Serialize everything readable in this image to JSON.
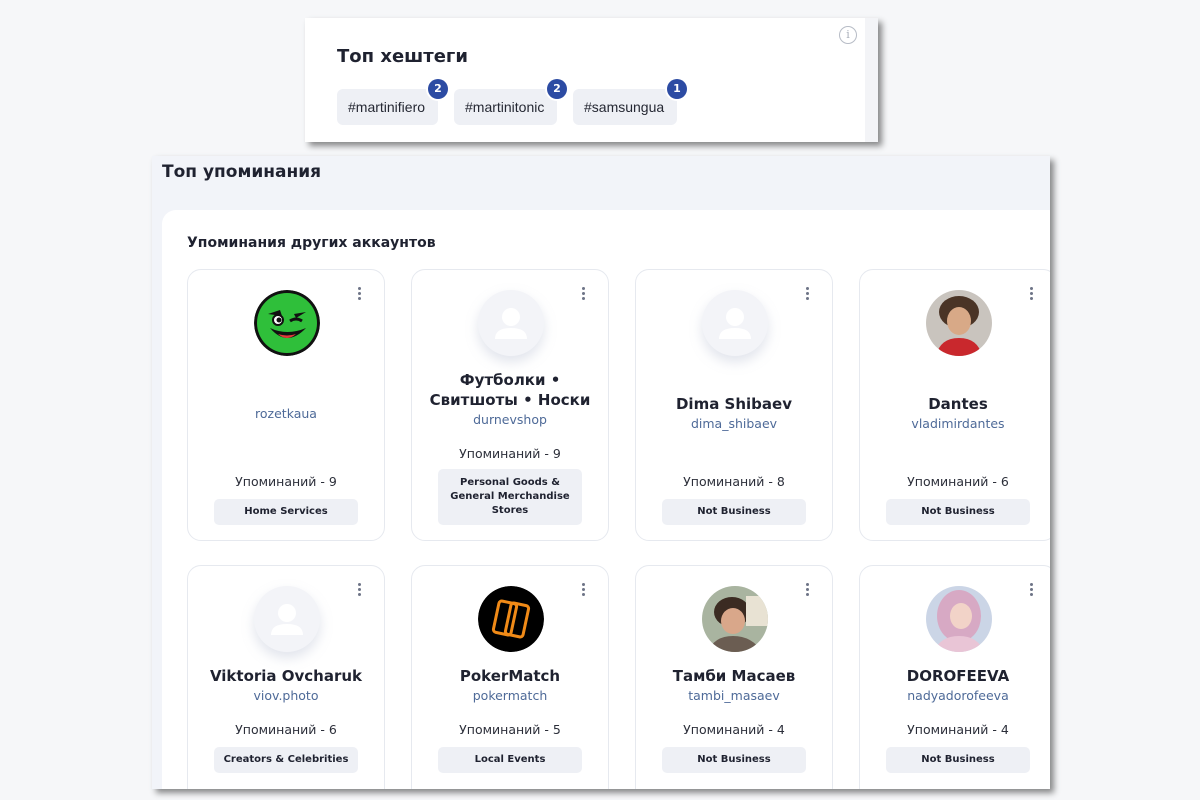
{
  "hashtags": {
    "title": "Топ хештеги",
    "items": [
      {
        "tag": "#martinifiero",
        "count": "2"
      },
      {
        "tag": "#martinitonic",
        "count": "2"
      },
      {
        "tag": "#samsungua",
        "count": "1"
      }
    ]
  },
  "mentions": {
    "title": "Топ упоминания",
    "subtitle": "Упоминания других аккаунтов",
    "accounts": [
      {
        "name": "",
        "handle": "rozetkaua",
        "count": "Упоминаний - 9",
        "category": "Home Services",
        "avatar": "rozetka-logo-icon"
      },
      {
        "name": "Футболки • Свитшоты • Носки",
        "handle": "durnevshop",
        "count": "Упоминаний - 9",
        "category": "Personal Goods & General Merchandise Stores",
        "avatar": "user-placeholder-icon"
      },
      {
        "name": "Dima Shibaev",
        "handle": "dima_shibaev",
        "count": "Упоминаний - 8",
        "category": "Not Business",
        "avatar": "user-placeholder-icon"
      },
      {
        "name": "Dantes",
        "handle": "vladimirdantes",
        "count": "Упоминаний - 6",
        "category": "Not Business",
        "avatar": "profile-photo"
      },
      {
        "name": "Viktoria Ovcharuk",
        "handle": "viov.photo",
        "count": "Упоминаний - 6",
        "category": "Creators & Celebrities",
        "avatar": "user-placeholder-icon"
      },
      {
        "name": "PokerMatch",
        "handle": "pokermatch",
        "count": "Упоминаний - 5",
        "category": "Local Events",
        "avatar": "pokermatch-logo-icon"
      },
      {
        "name": "Тамби Масаев",
        "handle": "tambi_masaev",
        "count": "Упоминаний - 4",
        "category": "Not Business",
        "avatar": "profile-photo"
      },
      {
        "name": "DOROFEEVA",
        "handle": "nadyadorofeeva",
        "count": "Упоминаний - 4",
        "category": "Not Business",
        "avatar": "profile-photo"
      }
    ]
  },
  "colors": {
    "badge": "#2c4ba3",
    "handle": "#4e6a98",
    "chip_bg": "#eef0f5"
  }
}
